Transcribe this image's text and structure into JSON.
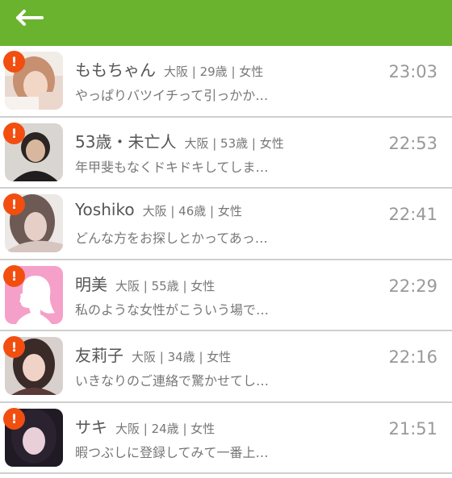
{
  "header": {
    "back_icon": "arrow-left-icon",
    "bg_color": "#6ab32f"
  },
  "messages": [
    {
      "name": "ももちゃん",
      "meta": "大阪 | 29歳 | 女性",
      "preview": "やっぱりバツイチって引っかか…",
      "time": "23:03",
      "alert": "!"
    },
    {
      "name": "53歳・未亡人",
      "meta": "大阪 | 53歳 | 女性",
      "preview": "年甲斐もなくドキドキしてしま…",
      "time": "22:53",
      "alert": "!"
    },
    {
      "name": "Yoshiko",
      "meta": "大阪 | 46歳 | 女性",
      "preview": "どんな方をお探しとかってあっ…",
      "time": "22:41",
      "alert": "!"
    },
    {
      "name": "明美",
      "meta": "大阪 | 55歳 | 女性",
      "preview": "私のような女性がこういう場で…",
      "time": "22:29",
      "alert": "!"
    },
    {
      "name": "友莉子",
      "meta": "大阪 | 34歳 | 女性",
      "preview": "いきなりのご連絡で驚かせてし…",
      "time": "22:16",
      "alert": "!"
    },
    {
      "name": "サキ",
      "meta": "大阪 | 24歳 | 女性",
      "preview": "暇つぶしに登録してみて一番上…",
      "time": "21:51",
      "alert": "!"
    }
  ],
  "colors": {
    "alert": "#f24e10",
    "divider": "#cfcfcf",
    "placeholder_avatar": "#f5a0c8"
  }
}
